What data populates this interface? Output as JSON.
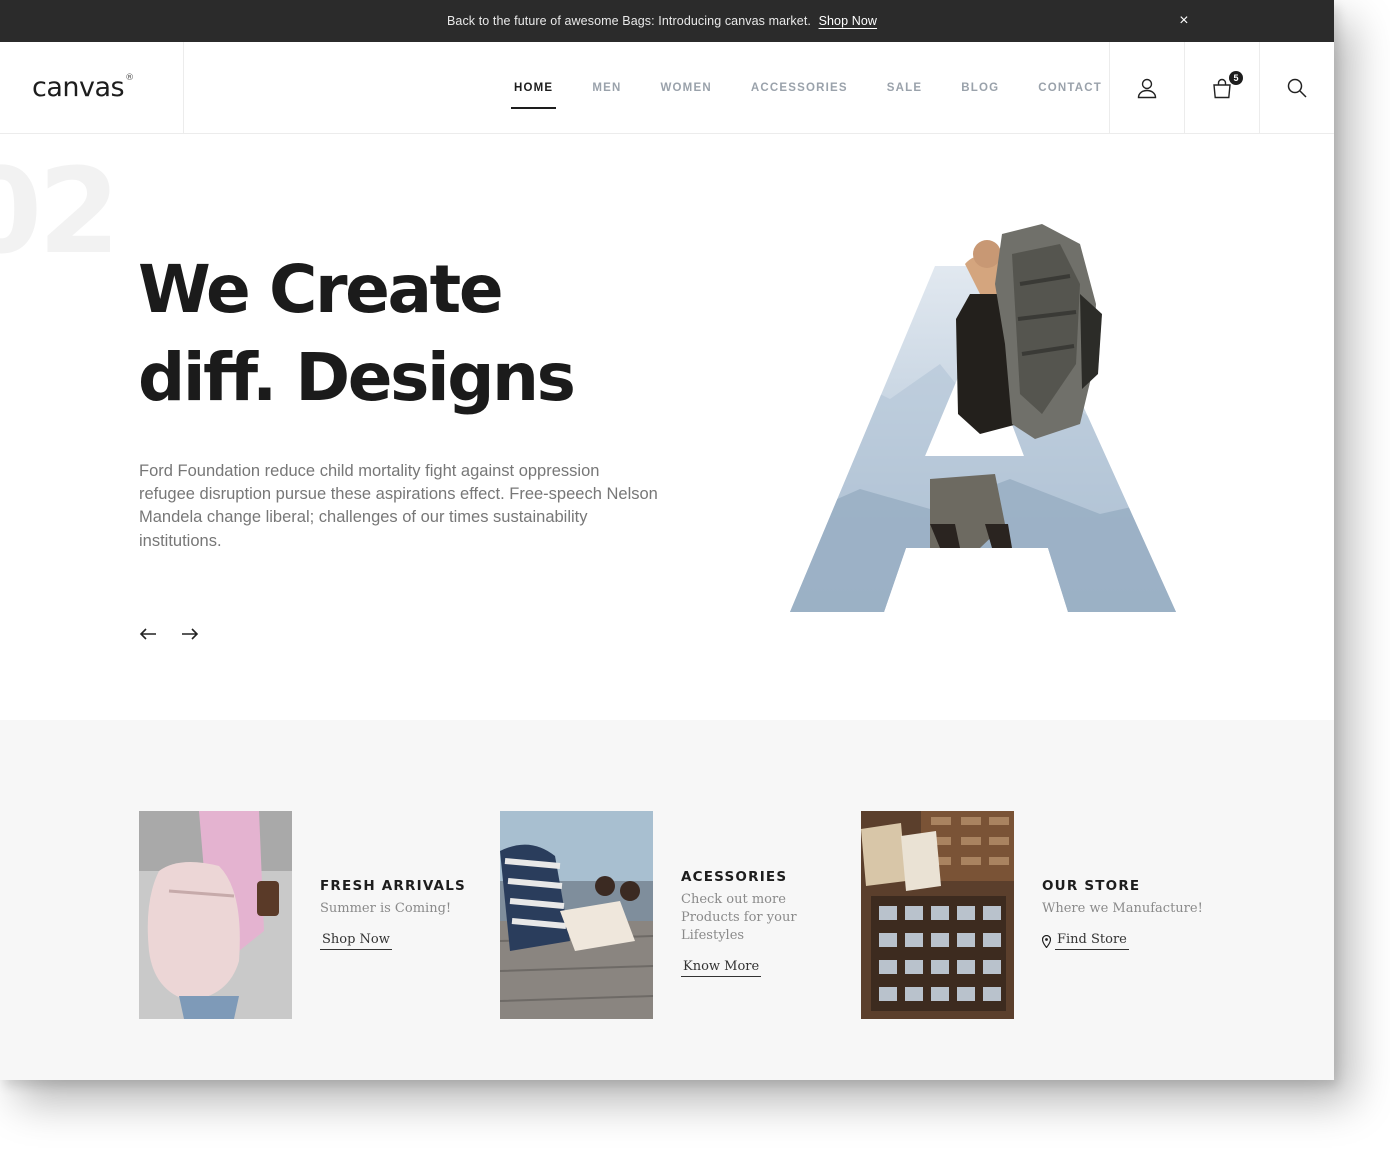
{
  "announcement": {
    "message": "Back to the future of awesome Bags: Introducing canvas market.",
    "link": "Shop Now",
    "close": "×"
  },
  "header": {
    "logo": "canvas",
    "logo_mark": "®",
    "nav": [
      "HOME",
      "MEN",
      "WOMEN",
      "ACCESSORIES",
      "SALE",
      "BLOG",
      "CONTACT"
    ],
    "active_nav": "HOME",
    "cart_count": "5",
    "icons": [
      "user-icon",
      "bag-icon",
      "search-icon"
    ]
  },
  "hero": {
    "slide_number": "02",
    "title_line1": "We Create",
    "title_line2": "diff. Designs",
    "text": "Ford Foundation reduce child mortality fight against oppression refugee disruption pursue these aspirations effect. Free-speech Nelson Mandela change liberal; challenges of our times sustainability institutions.",
    "art_letter": "A",
    "prev": "←",
    "next": "→"
  },
  "features": [
    {
      "title": "FRESH ARRIVALS",
      "sub": "Summer is Coming!",
      "link": "Shop Now"
    },
    {
      "title": "ACESSORIES",
      "sub": "Check out more Products for your Lifestyles",
      "link": "Know More"
    },
    {
      "title": "OUR STORE",
      "sub": "Where we Manufacture!",
      "link": "Find Store",
      "link_icon": "map-pin-icon"
    }
  ],
  "colors": {
    "topbar": "#2b2b2b",
    "text_dark": "#1b1b1b",
    "nav_muted": "#9aa2ab",
    "section_bg": "#f7f7f7"
  }
}
